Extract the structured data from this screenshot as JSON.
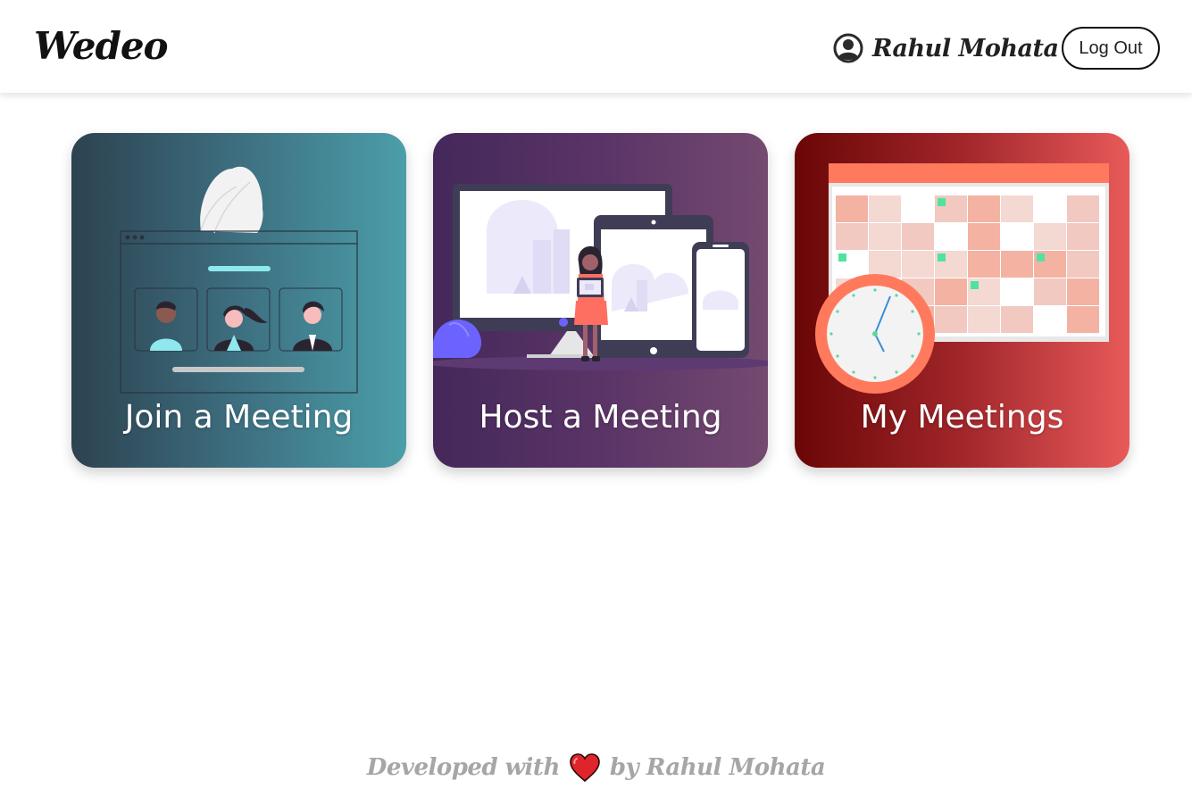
{
  "header": {
    "brand": "Wedeo",
    "user_name": "Rahul Mohata",
    "user_icon": "user-circle-icon",
    "logout_label": "Log Out"
  },
  "cards": [
    {
      "id": "join",
      "title": "Join a Meeting",
      "illustration": "video-conference-illustration"
    },
    {
      "id": "host",
      "title": "Host a Meeting",
      "illustration": "devices-presenter-illustration"
    },
    {
      "id": "my",
      "title": "My Meetings",
      "illustration": "calendar-clock-illustration"
    }
  ],
  "footer": {
    "prefix": "Developed with",
    "heart_icon": "heart-icon",
    "suffix": "by Rahul Mohata"
  },
  "colors": {
    "join_gradient": [
      "#2d4250",
      "#4b9ea9"
    ],
    "host_gradient": [
      "#45285a",
      "#744a70"
    ],
    "my_gradient": [
      "#6a0606",
      "#e85a5a"
    ],
    "heart": "#e0242b",
    "footer_text": "#a6a6a6"
  }
}
